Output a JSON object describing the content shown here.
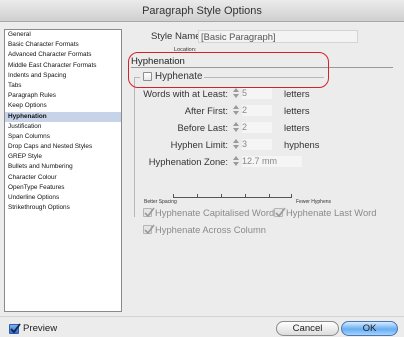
{
  "window": {
    "title": "Paragraph Style Options"
  },
  "sidebar": {
    "items": [
      {
        "label": "General",
        "selected": false
      },
      {
        "label": "Basic Character Formats",
        "selected": false
      },
      {
        "label": "Advanced Character Formats",
        "selected": false
      },
      {
        "label": "Middle East Character Formats",
        "selected": false
      },
      {
        "label": "Indents and Spacing",
        "selected": false
      },
      {
        "label": "Tabs",
        "selected": false
      },
      {
        "label": "Paragraph Rules",
        "selected": false
      },
      {
        "label": "Keep Options",
        "selected": false
      },
      {
        "label": "Hyphenation",
        "selected": true
      },
      {
        "label": "Justification",
        "selected": false
      },
      {
        "label": "Span Columns",
        "selected": false
      },
      {
        "label": "Drop Caps and Nested Styles",
        "selected": false
      },
      {
        "label": "GREP Style",
        "selected": false
      },
      {
        "label": "Bullets and Numbering",
        "selected": false
      },
      {
        "label": "Character Colour",
        "selected": false
      },
      {
        "label": "OpenType Features",
        "selected": false
      },
      {
        "label": "Underline Options",
        "selected": false
      },
      {
        "label": "Strikethrough Options",
        "selected": false
      }
    ]
  },
  "style_name": {
    "label": "Style Name:",
    "value": "[Basic Paragraph]"
  },
  "location": {
    "label": "Location:"
  },
  "section": {
    "title": "Hyphenation"
  },
  "hyphenate": {
    "label": "Hyphenate",
    "checked": false
  },
  "fields": {
    "words_with_at_least": {
      "label": "Words with at Least:",
      "value": "5",
      "unit": "letters"
    },
    "after_first": {
      "label": "After First:",
      "value": "2",
      "unit": "letters"
    },
    "before_last": {
      "label": "Before Last:",
      "value": "2",
      "unit": "letters"
    },
    "hyphen_limit": {
      "label": "Hyphen Limit:",
      "value": "3",
      "unit": "hyphens"
    },
    "hyphenation_zone": {
      "label": "Hyphenation Zone:",
      "value": "12.7 mm"
    }
  },
  "slider": {
    "left_label": "Better Spacing",
    "right_label": "Fewer Hyphens"
  },
  "options": {
    "capitalised": {
      "label": "Hyphenate Capitalised Words",
      "checked": true
    },
    "last_word": {
      "label": "Hyphenate Last Word",
      "checked": true
    },
    "across_column": {
      "label": "Hyphenate Across Column",
      "checked": true
    }
  },
  "preview": {
    "label": "Preview",
    "checked": true
  },
  "buttons": {
    "cancel": "Cancel",
    "ok": "OK"
  }
}
